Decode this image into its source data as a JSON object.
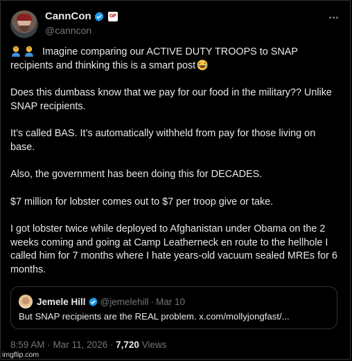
{
  "post": {
    "author": {
      "display_name": "CannCon",
      "handle": "@canncon",
      "affiliate_badge": "GP"
    },
    "paragraphs": [
      "Imagine comparing our ACTIVE DUTY TROOPS to SNAP recipients and thinking this is a smart post",
      "Does this dumbass know that we pay for our food in the military?? Unlike SNAP recipients.",
      "It’s called BAS.  It’s automatically withheld from pay for those living on base.",
      "Also, the government has been doing this for DECADES.",
      "$7 million for lobster comes out to $7 per troop give or take.",
      "I got lobster twice while deployed to Afghanistan under Obama on the 2 weeks coming and going at Camp Leatherneck en route to the hellhole I called him for 7 months where I hate years-old vacuum sealed MREs for 6 months."
    ],
    "quote": {
      "display_name": "Jemele Hill",
      "handle": "@jemelehill",
      "separator": "·",
      "date": "Mar 10",
      "text": "But SNAP recipients are the REAL problem. x.com/mollyjongfast/..."
    },
    "meta": {
      "time": "8:59 AM",
      "separator": "·",
      "date": "Mar 11, 2026",
      "separator2": "·",
      "views_count": "7,720",
      "views_label": "Views"
    }
  },
  "watermark": "imgflip.com",
  "colors": {
    "background": "#000000",
    "text": "#e7e9ea",
    "secondary": "#71767b",
    "verified_blue": "#1d9bf0",
    "border": "#2f3336"
  },
  "icons": [
    "verified-badge-icon",
    "affiliate-badge-icon",
    "more-options-icon",
    "facepalm-emoji-icon",
    "laughing-emoji-icon"
  ]
}
